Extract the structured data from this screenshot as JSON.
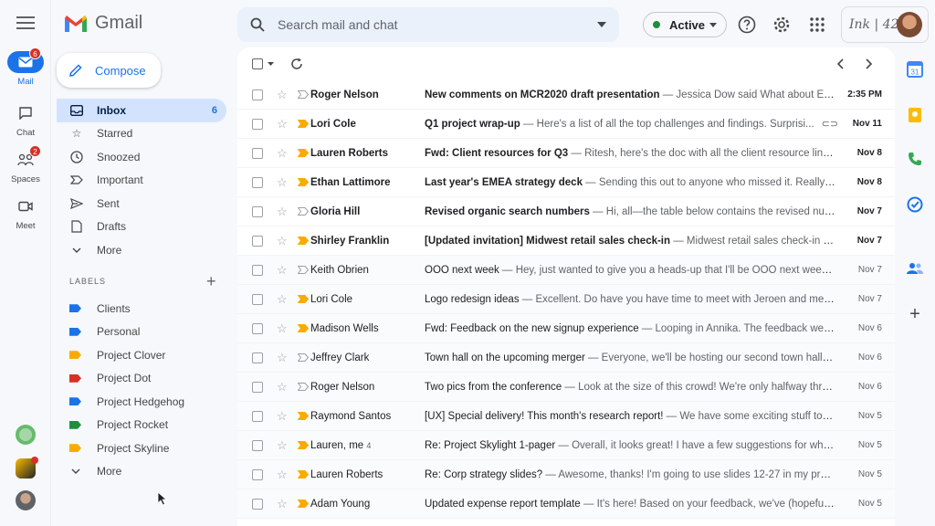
{
  "rail": {
    "items": [
      {
        "label": "Mail",
        "badge": "6",
        "icon": "mail-icon"
      },
      {
        "label": "Chat",
        "badge": "",
        "icon": "chat-icon"
      },
      {
        "label": "Spaces",
        "badge": "2",
        "icon": "spaces-icon"
      },
      {
        "label": "Meet",
        "badge": "",
        "icon": "meet-icon"
      }
    ]
  },
  "app": {
    "name": "Gmail"
  },
  "search": {
    "placeholder": "Search mail and chat"
  },
  "status": {
    "label": "Active",
    "color": "#1e8e3e"
  },
  "brand": {
    "text": "Ink | 42"
  },
  "compose": {
    "label": "Compose"
  },
  "nav": [
    {
      "label": "Inbox",
      "count": "6",
      "icon": "inbox-icon"
    },
    {
      "label": "Starred",
      "count": "",
      "icon": "star-icon"
    },
    {
      "label": "Snoozed",
      "count": "",
      "icon": "clock-icon"
    },
    {
      "label": "Important",
      "count": "",
      "icon": "important-icon"
    },
    {
      "label": "Sent",
      "count": "",
      "icon": "send-icon"
    },
    {
      "label": "Drafts",
      "count": "",
      "icon": "draft-icon"
    },
    {
      "label": "More",
      "count": "",
      "icon": "chevron-down-icon"
    }
  ],
  "labels": {
    "heading": "LABELS",
    "items": [
      {
        "label": "Clients",
        "color": "#1a73e8"
      },
      {
        "label": "Personal",
        "color": "#1a73e8"
      },
      {
        "label": "Project Clover",
        "color": "#f9ab00"
      },
      {
        "label": "Project Dot",
        "color": "#d93025"
      },
      {
        "label": "Project Hedgehog",
        "color": "#1a73e8"
      },
      {
        "label": "Project Rocket",
        "color": "#1e8e3e"
      },
      {
        "label": "Project Skyline",
        "color": "#f9ab00"
      }
    ],
    "more": "More"
  },
  "emails": [
    {
      "sender": "Roger Nelson",
      "count": "",
      "subject": "New comments on MCR2020 draft presentation",
      "snippet": " — Jessica Dow said What about Eva...",
      "date": "2:35 PM",
      "unread": true,
      "important": false,
      "attachment": false
    },
    {
      "sender": "Lori Cole",
      "count": "",
      "subject": "Q1 project wrap-up",
      "snippet": " — Here's a list of all the top challenges and findings. Surprisi...",
      "date": "Nov 11",
      "unread": true,
      "important": true,
      "attachment": true
    },
    {
      "sender": "Lauren Roberts",
      "count": "",
      "subject": "Fwd: Client resources for Q3",
      "snippet": " — Ritesh, here's the doc with all the client resource links ...",
      "date": "Nov 8",
      "unread": true,
      "important": true,
      "attachment": false
    },
    {
      "sender": "Ethan Lattimore",
      "count": "",
      "subject": "Last year's EMEA strategy deck",
      "snippet": " — Sending this out to anyone who missed it. Really gr...",
      "date": "Nov 8",
      "unread": true,
      "important": true,
      "attachment": false
    },
    {
      "sender": "Gloria Hill",
      "count": "",
      "subject": "Revised organic search numbers",
      "snippet": " — Hi, all—the table below contains the revised numbe...",
      "date": "Nov 7",
      "unread": true,
      "important": false,
      "attachment": false
    },
    {
      "sender": "Shirley Franklin",
      "count": "",
      "subject": "[Updated invitation] Midwest retail sales check-in",
      "snippet": " — Midwest retail sales check-in @ Tu...",
      "date": "Nov 7",
      "unread": true,
      "important": true,
      "attachment": false
    },
    {
      "sender": "Keith Obrien",
      "count": "",
      "subject": "OOO next week",
      "snippet": " — Hey, just wanted to give you a heads-up that I'll be OOO next week. If ...",
      "date": "Nov 7",
      "unread": false,
      "important": false,
      "attachment": false
    },
    {
      "sender": "Lori Cole",
      "count": "",
      "subject": "Logo redesign ideas",
      "snippet": " — Excellent. Do have you have time to meet with Jeroen and me thi...",
      "date": "Nov 7",
      "unread": false,
      "important": true,
      "attachment": false
    },
    {
      "sender": "Madison Wells",
      "count": "",
      "subject": "Fwd: Feedback on the new signup experience",
      "snippet": " — Looping in Annika. The feedback we've...",
      "date": "Nov 6",
      "unread": false,
      "important": true,
      "attachment": false
    },
    {
      "sender": "Jeffrey Clark",
      "count": "",
      "subject": "Town hall on the upcoming merger",
      "snippet": " — Everyone, we'll be hosting our second town hall to ...",
      "date": "Nov 6",
      "unread": false,
      "important": false,
      "attachment": false
    },
    {
      "sender": "Roger Nelson",
      "count": "",
      "subject": "Two pics from the conference",
      "snippet": " — Look at the size of this crowd! We're only halfway throu...",
      "date": "Nov 6",
      "unread": false,
      "important": false,
      "attachment": false
    },
    {
      "sender": "Raymond Santos",
      "count": "",
      "subject": "[UX] Special delivery! This month's research report!",
      "snippet": " — We have some exciting stuff to sh...",
      "date": "Nov 5",
      "unread": false,
      "important": true,
      "attachment": false
    },
    {
      "sender": "Lauren, me",
      "count": "4",
      "subject": "Re: Project Skylight 1-pager",
      "snippet": " — Overall, it looks great! I have a few suggestions for what t...",
      "date": "Nov 5",
      "unread": false,
      "important": true,
      "attachment": false
    },
    {
      "sender": "Lauren Roberts",
      "count": "",
      "subject": "Re: Corp strategy slides?",
      "snippet": " — Awesome, thanks! I'm going to use slides 12-27 in my presen...",
      "date": "Nov 5",
      "unread": false,
      "important": true,
      "attachment": false
    },
    {
      "sender": "Adam Young",
      "count": "",
      "subject": "Updated expense report template",
      "snippet": " — It's here! Based on your feedback, we've (hopefully)...",
      "date": "Nov 5",
      "unread": false,
      "important": true,
      "attachment": false
    }
  ],
  "colors": {
    "accent": "#1a73e8",
    "important": "#f9ab00",
    "badge": "#d93025"
  }
}
